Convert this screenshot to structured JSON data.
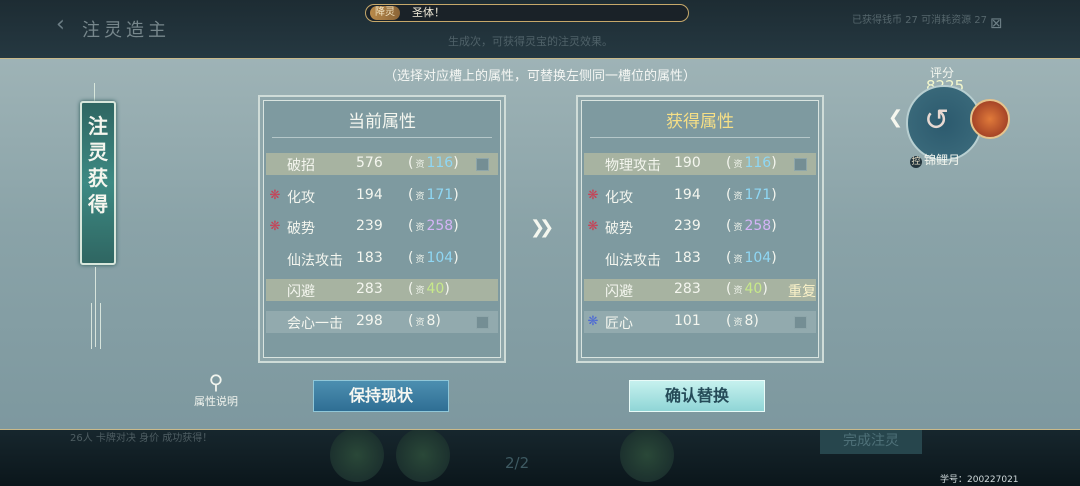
{
  "background": {
    "back_arrow": "‹",
    "title": "注灵造主",
    "subtitle": "生成次，可获得灵宝的注灵效果。",
    "top_right": "已获得钱币 27 可消耗资源 27",
    "close_icon": "⊠",
    "bottom_left": "26人 卡牌对决 身价 成功获得！",
    "bottom_num": "2/2",
    "bottom_button": "完成注灵",
    "student_id": "学号：200227021"
  },
  "banner": {
    "tag": "降灵",
    "message": "圣体！"
  },
  "modal": {
    "hint": "（选择对应槽上的属性，可替换左侧同一槽位的属性）",
    "side_scroll": "注灵获得",
    "help_label": "属性说明",
    "quality_prefix": "资"
  },
  "current": {
    "title": "当前属性",
    "rows": [
      {
        "name": "破招",
        "value": "576",
        "q": "116",
        "icon": "",
        "style": "hl"
      },
      {
        "name": "化攻",
        "value": "194",
        "q": "171",
        "icon": "❋",
        "style": ""
      },
      {
        "name": "破势",
        "value": "239",
        "q": "258",
        "icon": "❋",
        "style": ""
      },
      {
        "name": "仙法攻击",
        "value": "183",
        "q": "104",
        "icon": "",
        "style": ""
      },
      {
        "name": "闪避",
        "value": "283",
        "q": "40",
        "icon": "",
        "style": "hl"
      },
      {
        "name": "会心一击",
        "value": "298",
        "q": "8",
        "icon": "",
        "style": "mid"
      }
    ]
  },
  "obtained": {
    "title": "获得属性",
    "duplicate_label": "重复",
    "rows": [
      {
        "name": "物理攻击",
        "value": "190",
        "q": "116",
        "icon": "",
        "style": "hl"
      },
      {
        "name": "化攻",
        "value": "194",
        "q": "171",
        "icon": "❋",
        "style": ""
      },
      {
        "name": "破势",
        "value": "239",
        "q": "258",
        "icon": "❋",
        "style": ""
      },
      {
        "name": "仙法攻击",
        "value": "183",
        "q": "104",
        "icon": "",
        "style": ""
      },
      {
        "name": "闪避",
        "value": "283",
        "q": "40",
        "icon": "",
        "style": "hl"
      },
      {
        "name": "匠心",
        "value": "101",
        "q": "8",
        "icon": "❋",
        "style": "mid"
      }
    ]
  },
  "buttons": {
    "keep": "保持现状",
    "confirm": "确认替换"
  },
  "artifact": {
    "score_label": "评分",
    "score": "8225",
    "lock_icon": "控",
    "name": "锦鲤月"
  },
  "colors": {
    "quality_blue": "#8fd7f4",
    "quality_purple": "#d4b4f6",
    "quality_green": "#c7e98a",
    "gold_title": "#f6df86"
  }
}
